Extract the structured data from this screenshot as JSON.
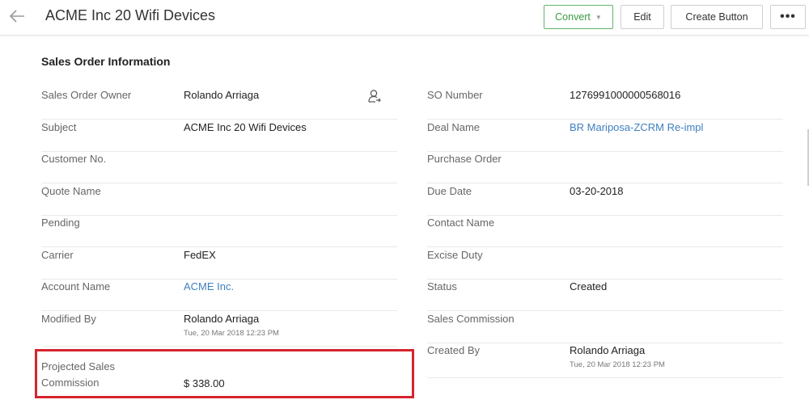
{
  "header": {
    "title": "ACME Inc 20 Wifi Devices",
    "convert_label": "Convert",
    "edit_label": "Edit",
    "create_button_label": "Create Button",
    "more_label": "•••"
  },
  "section": {
    "title": "Sales Order Information"
  },
  "left_fields": [
    {
      "label": "Sales Order Owner",
      "value": "Rolando Arriaga"
    },
    {
      "label": "Subject",
      "value": "ACME Inc 20 Wifi Devices"
    },
    {
      "label": "Customer No.",
      "value": ""
    },
    {
      "label": "Quote Name",
      "value": ""
    },
    {
      "label": "Pending",
      "value": ""
    },
    {
      "label": "Carrier",
      "value": "FedEX"
    },
    {
      "label": "Account Name",
      "value": "ACME Inc."
    },
    {
      "label": "Modified By",
      "value": "Rolando Arriaga",
      "sub": "Tue, 20 Mar 2018 12:23 PM"
    },
    {
      "label_line1": "Projected Sales",
      "label_line2": "Commission",
      "value": "$ 338.00"
    }
  ],
  "right_fields": [
    {
      "label": "SO Number",
      "value": "1276991000000568016"
    },
    {
      "label": "Deal Name",
      "value": "BR Mariposa-ZCRM Re-impl"
    },
    {
      "label": "Purchase Order",
      "value": ""
    },
    {
      "label": "Due Date",
      "value": "03-20-2018"
    },
    {
      "label": "Contact Name",
      "value": ""
    },
    {
      "label": "Excise Duty",
      "value": ""
    },
    {
      "label": "Status",
      "value": "Created"
    },
    {
      "label": "Sales Commission",
      "value": ""
    },
    {
      "label": "Created By",
      "value": "Rolando Arriaga",
      "sub": "Tue, 20 Mar 2018 12:23 PM"
    }
  ],
  "icons": {
    "back": "arrow-left-icon",
    "owner": "user-change-icon",
    "convert_caret": "caret-down-icon"
  },
  "colors": {
    "link": "#3f7fbf",
    "convert_border": "#63b46b",
    "highlight": "#d6242e"
  }
}
